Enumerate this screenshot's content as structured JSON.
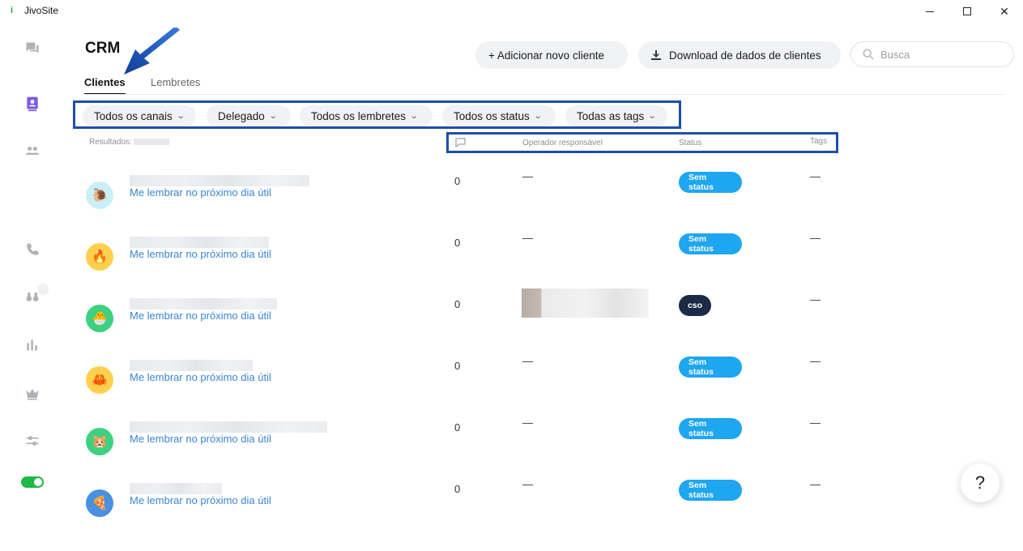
{
  "window": {
    "app_icon": "i",
    "title": "JivoSite",
    "minimize": "minimize-icon",
    "maximize": "maximize-icon",
    "close": "✕"
  },
  "header": {
    "title": "CRM"
  },
  "tabs": [
    {
      "label": "Clientes",
      "active": true
    },
    {
      "label": "Lembretes",
      "active": false
    }
  ],
  "toolbar": {
    "add_label": "+ Adicionar novo cliente",
    "download_label": "Download de dados de clientes",
    "search_placeholder": "Busca"
  },
  "filters": [
    {
      "label": "Todos os canais",
      "icon": "chevron-down-icon"
    },
    {
      "label": "Delegado",
      "icon": "chevron-down-icon"
    },
    {
      "label": "Todos os lembretes",
      "icon": "chevron-down-icon"
    },
    {
      "label": "Todos os status",
      "icon": "chevron-down-icon"
    },
    {
      "label": "Todas as tags",
      "icon": "chevron-down-icon"
    }
  ],
  "results_label": "Resultados:",
  "columns": {
    "chat_icon": "chat-bubble-icon",
    "operator": "Operador responsável",
    "status": "Status",
    "tags": "Tags"
  },
  "rows": [
    {
      "avatar": "🐌",
      "avatar_bg": "#c9f0f7",
      "reminder": "Me lembrar no próximo dia útil",
      "count": "0",
      "operator": "—",
      "status": "Sem status",
      "tags": "—"
    },
    {
      "avatar": "🔥",
      "avatar_bg": "#ffd04d",
      "reminder": "Me lembrar no próximo dia útil",
      "count": "0",
      "operator": "—",
      "status": "Sem status",
      "tags": "—"
    },
    {
      "avatar": "🐣",
      "avatar_bg": "#3ed17f",
      "reminder": "Me lembrar no próximo dia útil",
      "count": "0",
      "operator": "",
      "status": "cso",
      "tags": "—"
    },
    {
      "avatar": "🦀",
      "avatar_bg": "#ffd04d",
      "reminder": "Me lembrar no próximo dia útil",
      "count": "0",
      "operator": "—",
      "status": "Sem status",
      "tags": "—"
    },
    {
      "avatar": "🐹",
      "avatar_bg": "#3ed17f",
      "reminder": "Me lembrar no próximo dia útil",
      "count": "0",
      "operator": "—",
      "status": "Sem status",
      "tags": "—"
    },
    {
      "avatar": "🍕",
      "avatar_bg": "#4a90e2",
      "reminder": "Me lembrar no próximo dia útil",
      "count": "0",
      "operator": "—",
      "status": "Sem status",
      "tags": "—"
    }
  ],
  "help": {
    "label": "?"
  },
  "colors": {
    "accent": "#7b5ce6",
    "link": "#3a86d1",
    "status_blue": "#1ea6f0",
    "status_dark": "#1b2b45",
    "annotation": "#1e4fa8",
    "toggle_on": "#20b84a"
  }
}
